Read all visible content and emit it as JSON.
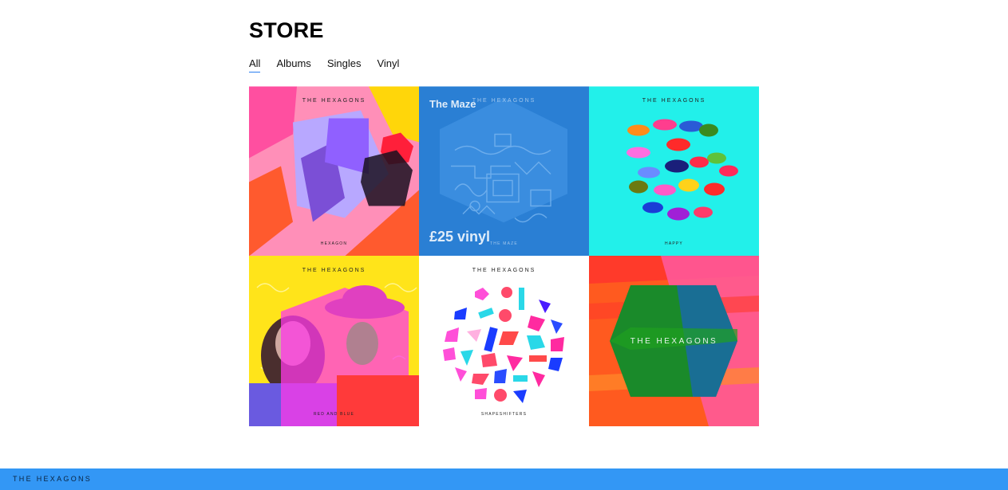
{
  "page": {
    "title": "STORE"
  },
  "filters": [
    {
      "label": "All",
      "active": true
    },
    {
      "label": "Albums",
      "active": false
    },
    {
      "label": "Singles",
      "active": false
    },
    {
      "label": "Vinyl",
      "active": false
    }
  ],
  "products": [
    {
      "band": "THE HEXAGONS",
      "cover_title": "HEXAGON",
      "bg": "#ff8fb0"
    },
    {
      "band": "THE HEXAGONS",
      "cover_title": "THE MAZE",
      "bg": "#2a7fd4",
      "overlay_title": "The Maze",
      "overlay_price": "£25 vinyl"
    },
    {
      "band": "THE HEXAGONS",
      "cover_title": "HAPPY",
      "bg": "#20f0ec"
    },
    {
      "band": "THE HEXAGONS",
      "cover_title": "RED AND BLUE",
      "bg": "#ffe41a"
    },
    {
      "band": "THE HEXAGONS",
      "cover_title": "SHAPESHIFTERS",
      "bg": "#ffffff"
    },
    {
      "band": "THE HEXAGONS",
      "bg": "#ff5a1f"
    }
  ],
  "footer": {
    "logo": "THE HEXAGONS",
    "bg": "#3397f5"
  }
}
